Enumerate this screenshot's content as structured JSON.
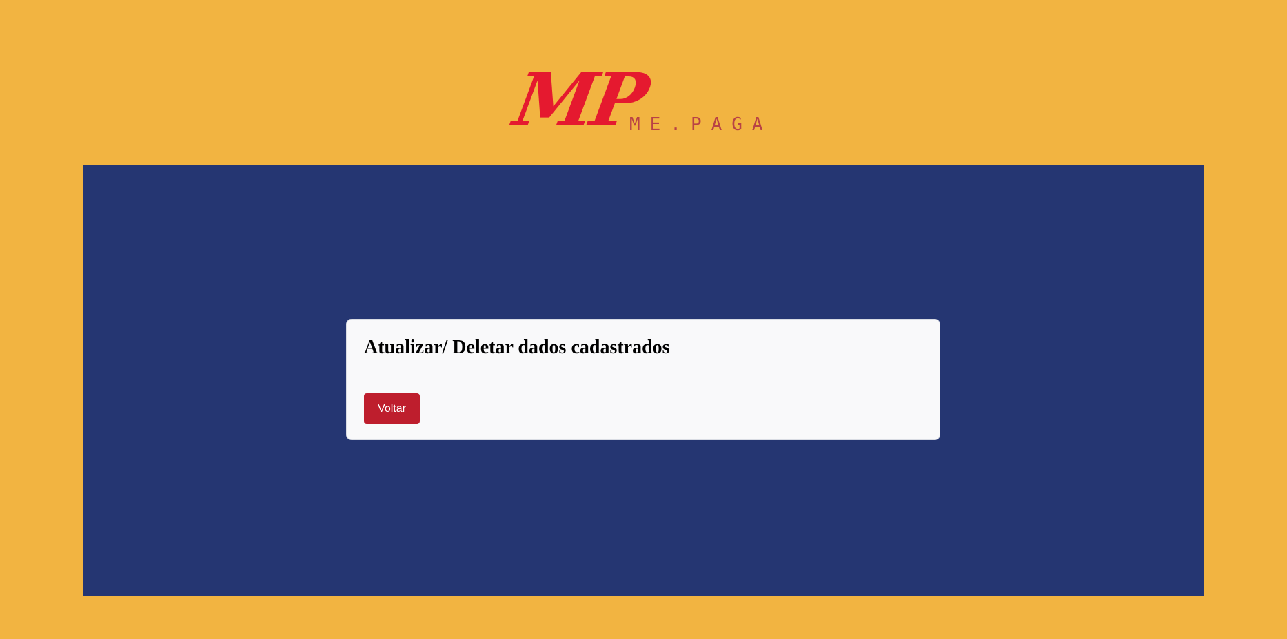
{
  "brand": {
    "logo_mark": "MP",
    "logo_tagline": "ME.PAGA",
    "primary_color": "#E5192F",
    "tagline_color": "#B94245"
  },
  "theme": {
    "page_background": "#F2B441",
    "panel_background": "#253672",
    "card_background": "#F9F9FA",
    "button_color": "#BE1E2D"
  },
  "card": {
    "title": "Atualizar/ Deletar dados cadastrados",
    "back_button_label": "Voltar"
  }
}
